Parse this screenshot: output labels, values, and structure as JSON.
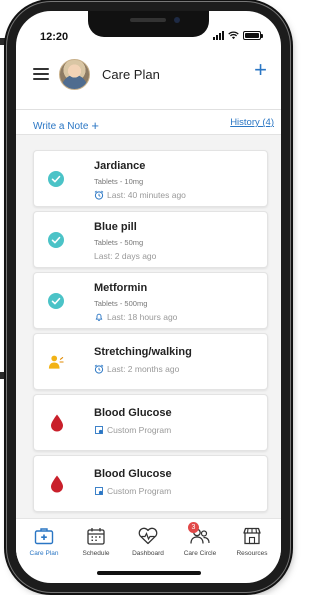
{
  "status_bar": {
    "time": "12:20"
  },
  "header": {
    "title": "Care Plan",
    "add_icon": "plus-icon",
    "menu_icon": "hamburger-icon"
  },
  "notes": {
    "write_label": "Write a Note",
    "history_label": "History (4)"
  },
  "colors": {
    "accent": "#2a76c4",
    "check_teal": "#4bc3c7",
    "drop_red": "#c9202b",
    "activity_yellow": "#f2b316",
    "badge_red": "#e14848"
  },
  "cards": [
    {
      "title": "Jardiance",
      "subtitle": "Tablets - 10mg",
      "meta": "Last: 40 minutes ago",
      "icon": "check-circle-icon",
      "meta_icon": "alarm-clock-icon"
    },
    {
      "title": "Blue pill",
      "subtitle": "Tablets - 50mg",
      "meta": "Last: 2 days ago",
      "icon": "check-circle-icon",
      "meta_icon": ""
    },
    {
      "title": "Metformin",
      "subtitle": "Tablets - 500mg",
      "meta": "Last: 18 hours ago",
      "icon": "check-circle-icon",
      "meta_icon": "bell-icon"
    },
    {
      "title": "Stretching/walking",
      "subtitle": "",
      "meta": "Last: 2 months ago",
      "icon": "person-activity-icon",
      "meta_icon": "alarm-clock-icon"
    },
    {
      "title": "Blood Glucose",
      "subtitle": "",
      "meta": "Custom Program",
      "icon": "blood-drop-icon",
      "meta_icon": "custom-program-icon"
    },
    {
      "title": "Blood Glucose",
      "subtitle": "",
      "meta": "Custom Program",
      "icon": "blood-drop-icon",
      "meta_icon": "custom-program-icon"
    }
  ],
  "bottom_nav": [
    {
      "label": "Care Plan",
      "icon": "first-aid-kit-icon",
      "active": true
    },
    {
      "label": "Schedule",
      "icon": "calendar-icon",
      "active": false
    },
    {
      "label": "Dashboard",
      "icon": "heart-monitor-icon",
      "active": false
    },
    {
      "label": "Care Circle",
      "icon": "people-icon",
      "active": false,
      "badge": "3"
    },
    {
      "label": "Resources",
      "icon": "storefront-icon",
      "active": false
    }
  ]
}
